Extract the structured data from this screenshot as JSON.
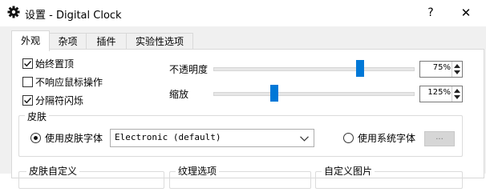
{
  "window": {
    "title": "设置 - Digital Clock",
    "help_label": "?",
    "close_label": "✕"
  },
  "tabs": [
    {
      "label": "外观",
      "active": true
    },
    {
      "label": "杂项",
      "active": false
    },
    {
      "label": "插件",
      "active": false
    },
    {
      "label": "实验性选项",
      "active": false
    }
  ],
  "appearance": {
    "checkboxes": [
      {
        "label": "始终置顶",
        "checked": true
      },
      {
        "label": "不响应鼠标操作",
        "checked": false
      },
      {
        "label": "分隔符闪烁",
        "checked": true
      }
    ],
    "opacity": {
      "label": "不透明度",
      "value": "75%",
      "slider_fraction": 0.75
    },
    "zoom": {
      "label": "缩放",
      "value": "125%",
      "slider_fraction": 0.29
    },
    "skin": {
      "title": "皮肤",
      "use_skin_font_label": "使用皮肤字体",
      "use_skin_font_selected": true,
      "skin_font_value": "Electronic (default)",
      "use_system_font_label": "使用系统字体",
      "use_system_font_selected": false,
      "system_font_button": "..."
    },
    "bottom_groups": [
      "皮肤自定义",
      "纹理选项",
      "自定义图片"
    ]
  },
  "colors": {
    "accent": "#0078d7",
    "tab_border": "#d9d9d9",
    "dialog_bg": "#f0f0f0"
  },
  "icons": {
    "app": "gear-icon",
    "combo": "chevron-down-icon"
  }
}
